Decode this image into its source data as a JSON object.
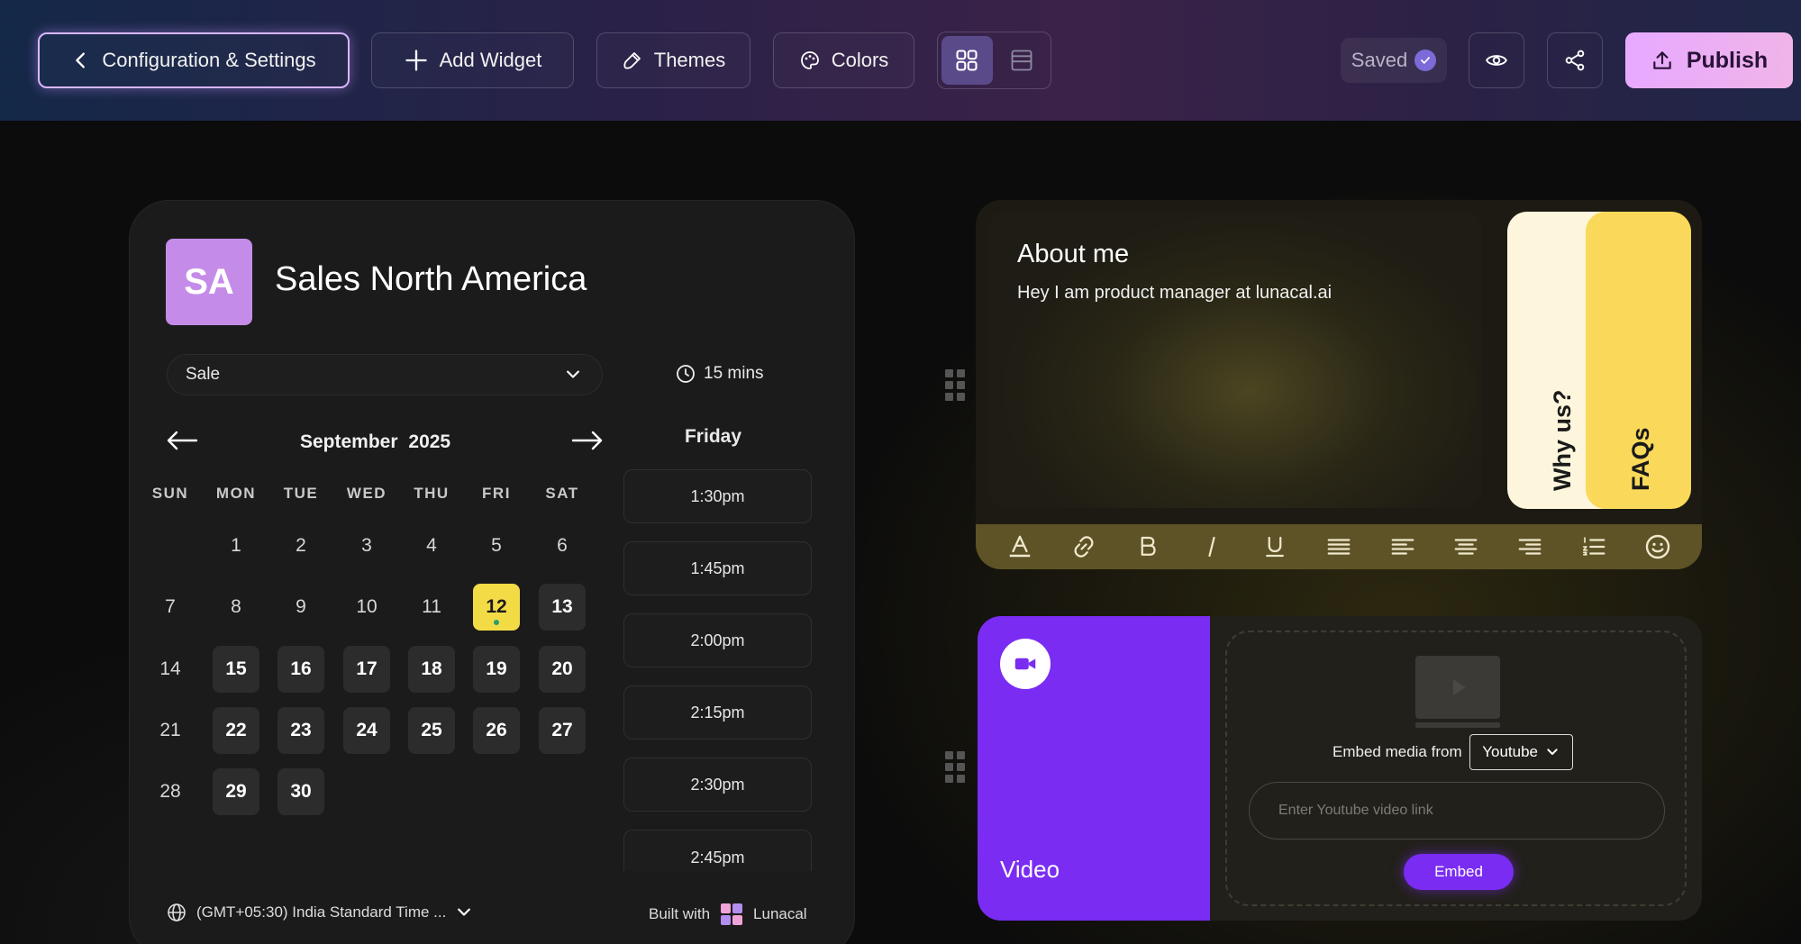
{
  "topbar": {
    "config_label": "Configuration & Settings",
    "add_widget_label": "Add Widget",
    "themes_label": "Themes",
    "colors_label": "Colors",
    "saved_label": "Saved",
    "publish_label": "Publish",
    "active_view": "grid"
  },
  "booking": {
    "avatar_initials": "SA",
    "team_name": "Sales North America",
    "event_type": "Sale",
    "duration": "15 mins",
    "calendar": {
      "month": "September",
      "year": "2025",
      "weekdays": [
        "SUN",
        "MON",
        "TUE",
        "WED",
        "THU",
        "FRI",
        "SAT"
      ],
      "first_weekday_index": 1,
      "days_in_month": 30,
      "available_days": [
        13,
        15,
        16,
        17,
        18,
        19,
        20,
        22,
        23,
        24,
        25,
        26,
        27,
        29,
        30
      ],
      "selected_day": 12
    },
    "slots_day": "Friday",
    "slots": [
      "1:30pm",
      "1:45pm",
      "2:00pm",
      "2:15pm",
      "2:30pm",
      "2:45pm"
    ],
    "timezone": "(GMT+05:30) India Standard Time ...",
    "built_with_label": "Built with",
    "brand_name": "Lunacal"
  },
  "about": {
    "title": "About me",
    "body": "Hey I am product manager at lunacal.ai",
    "tab_why": "Why us?",
    "tab_faq": "FAQs"
  },
  "video": {
    "title": "Video",
    "embed_from_label": "Embed media from",
    "source": "Youtube",
    "link_placeholder": "Enter Youtube video link",
    "embed_button": "Embed"
  },
  "colors": {
    "publish_bg": "#e7a9ff",
    "selected_day": "#f3db46",
    "video_accent": "#7a2cf2",
    "avatar_bg": "#c48ce8",
    "faq_tab": "#fad95a",
    "why_tab": "#fdf6dd",
    "toolbar_bg": "#5e5326"
  }
}
